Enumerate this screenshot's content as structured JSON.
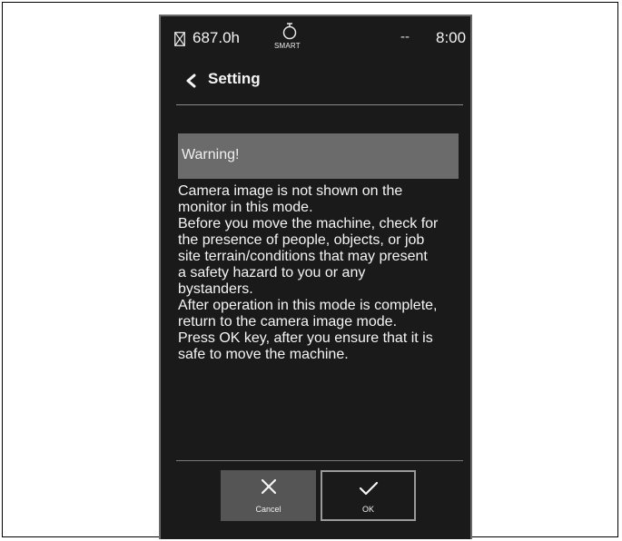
{
  "status_bar": {
    "hours": "687.0h",
    "smart_label": "SMART",
    "indicator": "--",
    "time": "8:00",
    "icons": [
      "hourglass-icon",
      "smart-engine-icon"
    ]
  },
  "header": {
    "back_icon": "chevron-left-icon",
    "title": "Setting"
  },
  "warning": {
    "heading": "Warning!",
    "lines": [
      "Camera image is not shown on the",
      "monitor in this mode.",
      "Before you move the machine, check for",
      "the presence of people, objects, or job",
      "site terrain/conditions that may present",
      "a safety hazard to you or any",
      "bystanders.",
      "After operation in this mode is complete,",
      "return to the camera image mode.",
      "Press OK key, after you ensure that it is",
      "safe to move the machine."
    ]
  },
  "buttons": {
    "cancel": {
      "label": "Cancel",
      "icon": "close-icon"
    },
    "ok": {
      "label": "OK",
      "icon": "check-icon"
    }
  },
  "colors": {
    "screen_bg": "#1a1a1a",
    "banner_bg": "#6b6b6b",
    "cancel_bg": "#555555",
    "text": "#f2f2f2"
  }
}
